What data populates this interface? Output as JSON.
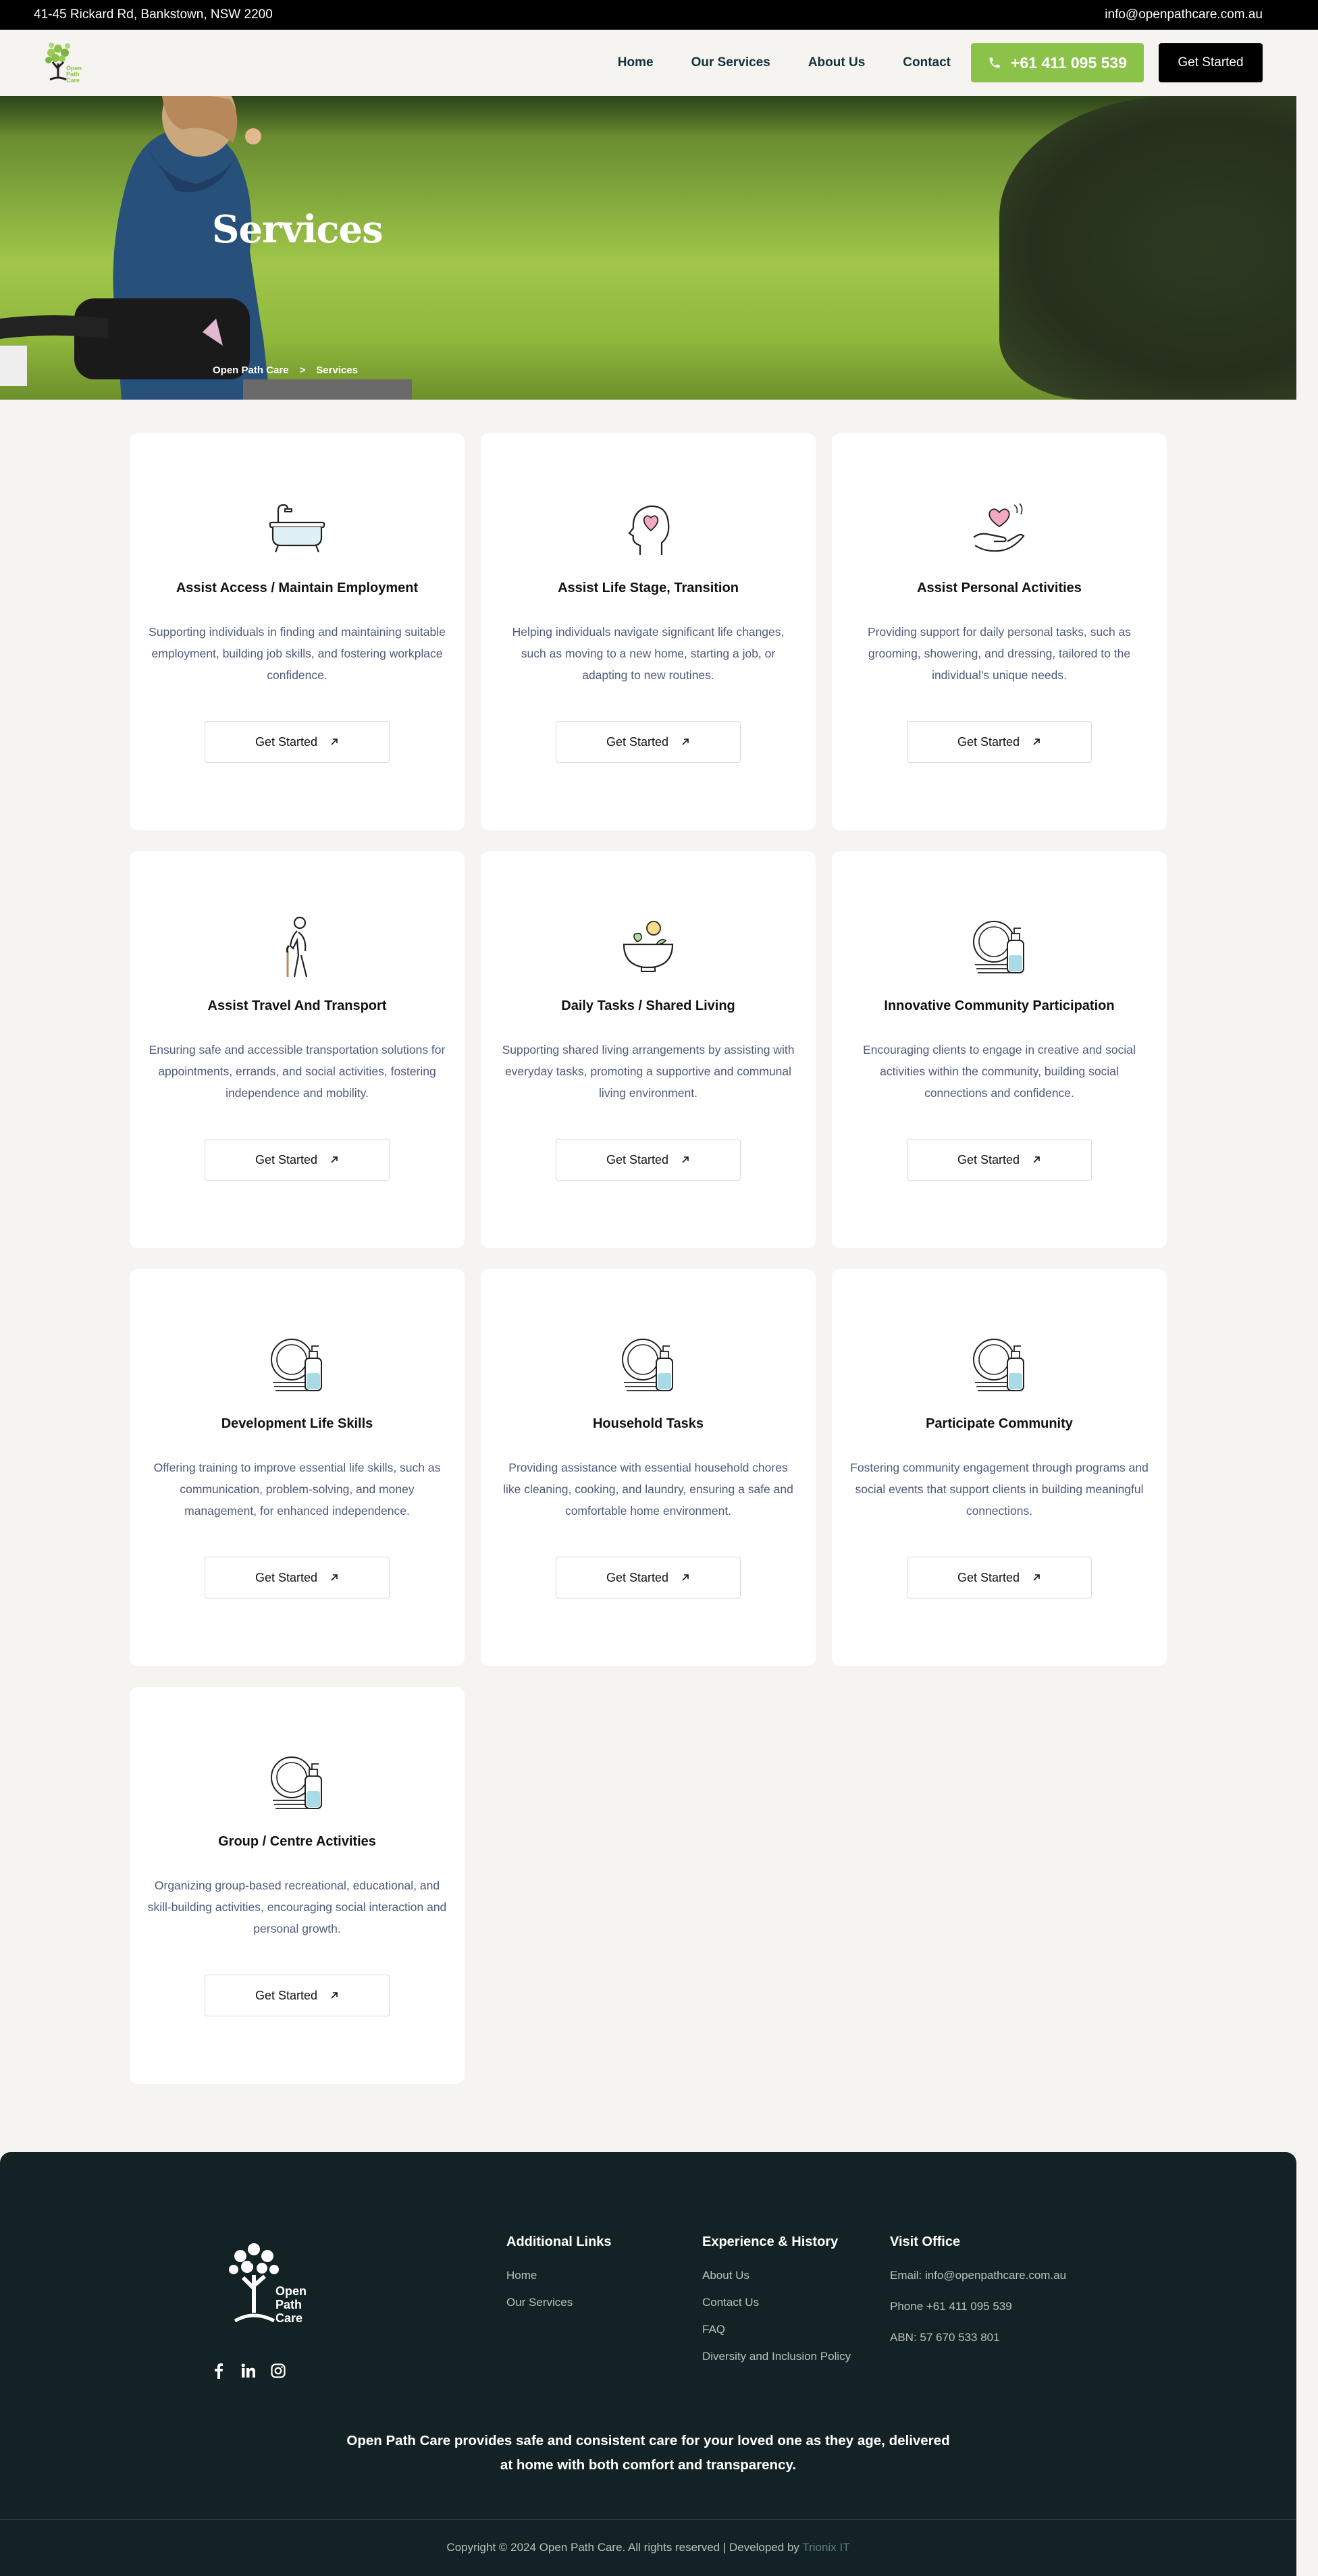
{
  "topbar": {
    "address": "41-45 Rickard Rd, Bankstown, NSW 2200",
    "email": "info@openpathcare.com.au"
  },
  "header": {
    "logo_text": "Open Path Care",
    "nav": [
      {
        "label": "Home"
      },
      {
        "label": "Our Services"
      },
      {
        "label": "About Us"
      },
      {
        "label": "Contact"
      }
    ],
    "phone_label": "+61 411 095 539",
    "cta_label": "Get Started"
  },
  "hero": {
    "title": "Services",
    "breadcrumb": {
      "home": "Open Path Care",
      "separator": ">",
      "current": "Services"
    }
  },
  "cards": [
    {
      "icon": "bathtub-icon",
      "title": "Assist Access / Maintain Employment",
      "desc": "Supporting individuals in finding and maintaining suitable employment, building job skills, and fostering workplace confidence.",
      "cta": "Get Started"
    },
    {
      "icon": "head-heart-icon",
      "title": "Assist Life Stage, Transition",
      "desc": "Helping individuals navigate significant life changes, such as moving to a new home, starting a job, or adapting to new routines.",
      "cta": "Get Started"
    },
    {
      "icon": "hand-heart-icon",
      "title": "Assist Personal Activities",
      "desc": "Providing support for daily personal tasks, such as grooming, showering, and dressing, tailored to the individual's unique needs.",
      "cta": "Get Started"
    },
    {
      "icon": "elderly-person-icon",
      "title": "Assist Travel And Transport",
      "desc": "Ensuring safe and accessible transportation solutions for appointments, errands, and social activities, fostering independence and mobility.",
      "cta": "Get Started"
    },
    {
      "icon": "bowl-icon",
      "title": "Daily Tasks / Shared Living",
      "desc": "Supporting shared living arrangements by assisting with everyday tasks, promoting a supportive and communal living environment.",
      "cta": "Get Started"
    },
    {
      "icon": "dishes-soap-icon",
      "title": "Innovative Community Participation",
      "desc": "Encouraging clients to engage in creative and social activities within the community, building social connections and confidence.",
      "cta": "Get Started"
    },
    {
      "icon": "dishes-soap-icon",
      "title": "Development Life Skills",
      "desc": "Offering training to improve essential life skills, such as communication, problem-solving, and money management, for enhanced independence.",
      "cta": "Get Started"
    },
    {
      "icon": "dishes-soap-icon",
      "title": "Household Tasks",
      "desc": "Providing assistance with essential household chores like cleaning, cooking, and laundry, ensuring a safe and comfortable home environment.",
      "cta": "Get Started"
    },
    {
      "icon": "dishes-soap-icon",
      "title": "Participate Community",
      "desc": "Fostering community engagement through programs and social events that support clients in building meaningful connections.",
      "cta": "Get Started"
    },
    {
      "icon": "dishes-soap-icon",
      "title": "Group / Centre Activities",
      "desc": "Organizing group-based recreational, educational, and skill-building activities, encouraging social interaction and personal growth.",
      "cta": "Get Started"
    }
  ],
  "footer": {
    "logo_text": "Open Path Care",
    "col1": {
      "title": "Additional Links",
      "links": [
        "Home",
        "Our Services"
      ]
    },
    "col2": {
      "title": "Experience & History",
      "links": [
        "About Us",
        "Contact Us",
        "FAQ",
        "Diversity and Inclusion Policy"
      ]
    },
    "col3": {
      "title": "Visit Office",
      "lines": [
        "Email: info@openpathcare.com.au",
        "Phone +61 411 095 539",
        "ABN: 57 670 533 801"
      ]
    },
    "tagline": "Open Path Care provides safe and consistent care for your loved one as they age, delivered at home with both comfort and transparency.",
    "copyright": "Copyright © 2024 Open Path Care. All rights reserved | Developed by",
    "developer": "Trionix IT"
  },
  "colors": {
    "accent_green": "#8bc34a",
    "footer_bg": "#132224",
    "desc_text": "#4d5b7a"
  }
}
